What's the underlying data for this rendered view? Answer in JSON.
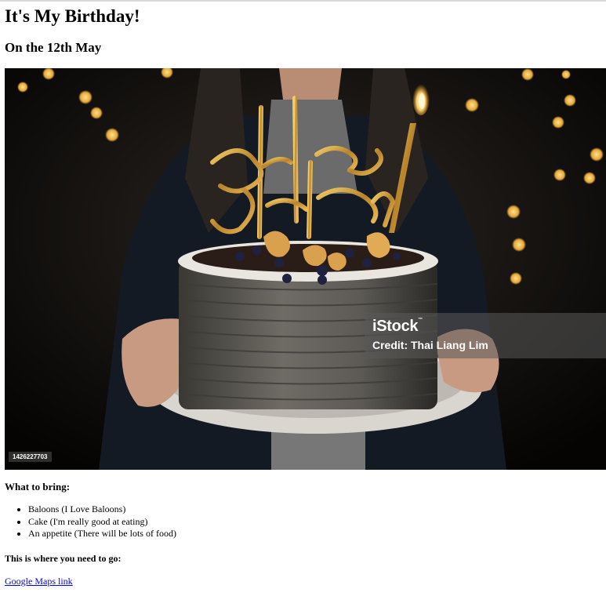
{
  "header": {
    "title": "It's My Birthday!",
    "subtitle": "On the 12th May"
  },
  "photo": {
    "topper_text": "Happy Birthday",
    "watermark_logo": "iStock",
    "watermark_tm": "™",
    "watermark_credit": "Credit: Thai Liang Lim",
    "image_id": "1426227703"
  },
  "bring": {
    "title": "What to bring:",
    "items": [
      "Baloons (I Love Baloons)",
      "Cake (I'm really good at eating)",
      "An appetite (There will be lots of food)"
    ]
  },
  "directions": {
    "title": "This is where you need to go:",
    "link_text": "Google Maps link"
  },
  "colors": {
    "link": "#0000ee",
    "bokeh": "#f2c24a",
    "frosting": "#5c5a55",
    "topper": "#c9962c"
  }
}
